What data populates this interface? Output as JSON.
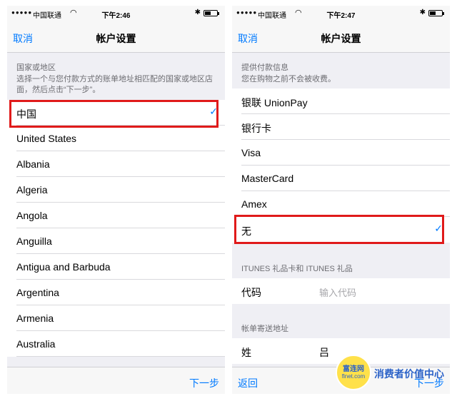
{
  "status": {
    "carrier": "中国联通",
    "time_left": "下午2:46",
    "time_right": "下午2:47"
  },
  "left": {
    "nav": {
      "cancel": "取消",
      "title": "帐户设置"
    },
    "section_header": "国家或地区",
    "section_desc": "选择一个与您付款方式的账单地址相匹配的国家或地区店面，然后点击“下一步”。",
    "countries": [
      {
        "label": "中国",
        "selected": true
      },
      {
        "label": "United States",
        "selected": false
      },
      {
        "label": "Albania",
        "selected": false
      },
      {
        "label": "Algeria",
        "selected": false
      },
      {
        "label": "Angola",
        "selected": false
      },
      {
        "label": "Anguilla",
        "selected": false
      },
      {
        "label": "Antigua and Barbuda",
        "selected": false
      },
      {
        "label": "Argentina",
        "selected": false
      },
      {
        "label": "Armenia",
        "selected": false
      },
      {
        "label": "Australia",
        "selected": false
      }
    ],
    "toolbar": {
      "next": "下一步"
    }
  },
  "right": {
    "nav": {
      "cancel": "取消",
      "title": "帐户设置"
    },
    "payment_header": "提供付款信息",
    "payment_desc": "您在购物之前不会被收费。",
    "payment_methods": [
      {
        "label": "银联 UnionPay",
        "selected": false
      },
      {
        "label": "银行卡",
        "selected": false
      },
      {
        "label": "Visa",
        "selected": false
      },
      {
        "label": "MasterCard",
        "selected": false
      },
      {
        "label": "Amex",
        "selected": false
      },
      {
        "label": "无",
        "selected": true
      }
    ],
    "itunes_header": "ITUNES 礼品卡和 ITUNES 礼品",
    "code_label": "代码",
    "code_placeholder": "输入代码",
    "billing_header": "帐单寄送地址",
    "surname_label": "姓",
    "surname_value": "吕",
    "toolbar": {
      "back": "返回",
      "next": "下一步"
    }
  },
  "watermark": {
    "logo_line1": "富连网",
    "logo_line2": "flnet.com",
    "slogan": "消费者价值中心"
  },
  "colors": {
    "accent": "#007aff",
    "highlight": "#e01a1a",
    "background": "#efeff4"
  },
  "icons": [
    "wifi-icon",
    "bluetooth-icon",
    "battery-icon",
    "checkmark-icon"
  ]
}
